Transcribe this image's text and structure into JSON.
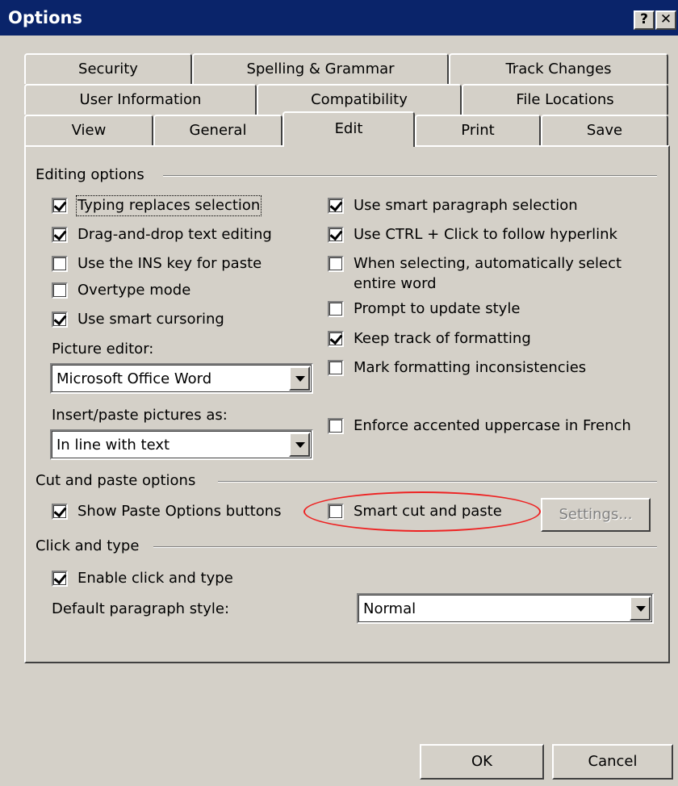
{
  "window": {
    "title": "Options",
    "help_glyph": "?",
    "close_glyph": "✕"
  },
  "tabs": {
    "row1": [
      "Security",
      "Spelling & Grammar",
      "Track Changes"
    ],
    "row2": [
      "User Information",
      "Compatibility",
      "File Locations"
    ],
    "row3": [
      "View",
      "General",
      "Edit",
      "Print",
      "Save"
    ],
    "active": "Edit"
  },
  "editing": {
    "header": "Editing options",
    "typing_replaces": {
      "label": "Typing replaces selection",
      "checked": true
    },
    "drag_drop": {
      "label": "Drag-and-drop text editing",
      "checked": true
    },
    "ins_key": {
      "label": "Use the INS key for paste",
      "checked": false
    },
    "overtype": {
      "label": "Overtype mode",
      "checked": false
    },
    "smart_cursoring": {
      "label": "Use smart cursoring",
      "checked": true
    },
    "picture_editor_label": "Picture editor:",
    "picture_editor_value": "Microsoft Office Word",
    "insert_paste_label": "Insert/paste pictures as:",
    "insert_paste_value": "In line with text",
    "smart_paragraph": {
      "label": "Use smart paragraph selection",
      "checked": true
    },
    "ctrl_click": {
      "label": "Use CTRL + Click to follow hyperlink",
      "checked": true
    },
    "auto_select_word": {
      "label_line1": "When selecting, automatically select",
      "label_line2": "entire word",
      "checked": false
    },
    "prompt_update_style": {
      "label": "Prompt to update style",
      "checked": false
    },
    "keep_track": {
      "label": "Keep track of formatting",
      "checked": true
    },
    "mark_inconsistencies": {
      "label": "Mark formatting inconsistencies",
      "checked": false
    },
    "enforce_accented": {
      "label": "Enforce accented uppercase in French",
      "checked": false
    }
  },
  "cut_paste": {
    "header": "Cut and paste options",
    "show_paste_options": {
      "label": "Show Paste Options buttons",
      "checked": true
    },
    "smart_cut": {
      "label": "Smart cut and paste",
      "checked": false
    },
    "settings_button": "Settings..."
  },
  "click_type": {
    "header": "Click and type",
    "enable": {
      "label": "Enable click and type",
      "checked": true
    },
    "default_style_label": "Default paragraph style:",
    "default_style_value": "Normal"
  },
  "footer": {
    "ok": "OK",
    "cancel": "Cancel"
  },
  "colors": {
    "titlebar": "#0a246a",
    "face": "#d4d0c8",
    "annotation": "#e22222"
  }
}
